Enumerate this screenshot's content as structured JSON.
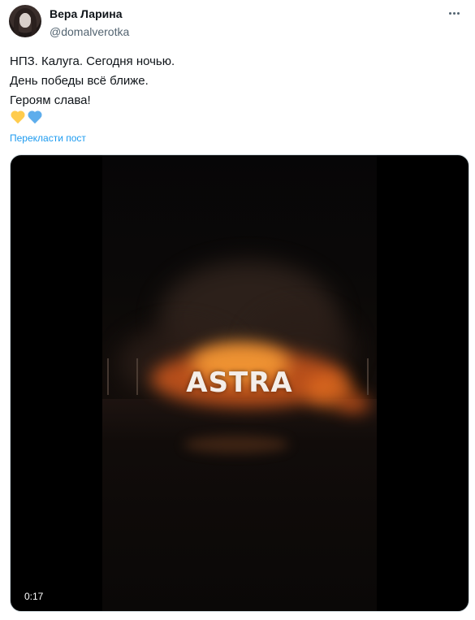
{
  "author": {
    "display_name": "Вера Ларина",
    "handle": "@domalverotka",
    "avatar_icon": "avatar-photo"
  },
  "tweet": {
    "lines": [
      "НПЗ. Калуга. Сегодня ночью.",
      "День победы всё ближе.",
      "Героям слава!"
    ],
    "emoji": [
      "yellow-heart",
      "blue-heart"
    ],
    "translate_label": "Перекласти пост"
  },
  "media": {
    "type": "video",
    "watermark": "ASTRA",
    "duration": "0:17"
  },
  "icons": {
    "more": "more-horizontal-icon"
  },
  "colors": {
    "link": "#1d9bf0",
    "secondary_text": "#536471",
    "heart_yellow": "#ffcc4d",
    "heart_blue": "#5dadec"
  }
}
